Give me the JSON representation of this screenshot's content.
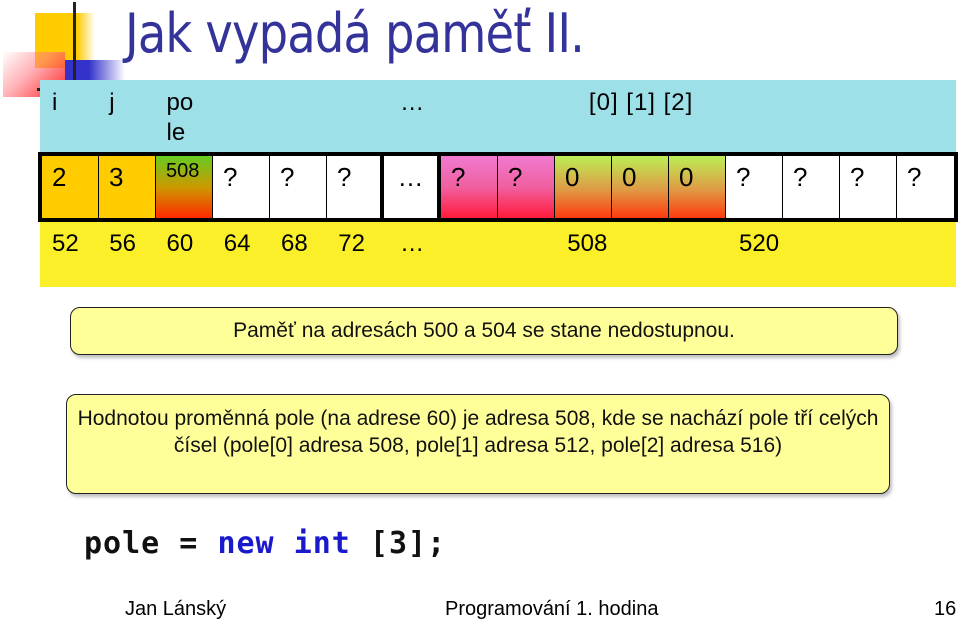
{
  "slide": {
    "title": "Jak vypadá paměť II.",
    "header_row": {
      "cells": [
        "i",
        "j",
        "po\nle",
        "",
        "",
        "",
        "…",
        "",
        "",
        "[0]  [1]  [2]",
        "",
        "",
        "",
        ""
      ]
    },
    "memory_row": {
      "cells": [
        {
          "value": "2",
          "kind": "orange"
        },
        {
          "value": "3",
          "kind": "orange"
        },
        {
          "value": "508",
          "kind": "pointer"
        },
        {
          "value": "?",
          "kind": "white"
        },
        {
          "value": "?",
          "kind": "white"
        },
        {
          "value": "?",
          "kind": "white"
        },
        {
          "value": "…",
          "kind": "white"
        },
        {
          "value": "?",
          "kind": "pink"
        },
        {
          "value": "?",
          "kind": "pink"
        },
        {
          "value": "0",
          "kind": "array"
        },
        {
          "value": "0",
          "kind": "array"
        },
        {
          "value": "0",
          "kind": "array"
        },
        {
          "value": "?",
          "kind": "white"
        },
        {
          "value": "?",
          "kind": "white"
        },
        {
          "value": "?",
          "kind": "white"
        },
        {
          "value": "?",
          "kind": "white"
        }
      ]
    },
    "address_row": {
      "cells": [
        "52",
        "56",
        "60",
        "64",
        "68",
        "72",
        "…",
        "",
        "",
        "508",
        "",
        "",
        "520",
        "",
        "",
        ""
      ]
    },
    "callout_unreachable": "Paměť na adresách 500 a 504 se stane nedostupnou.",
    "callout_explanation": "Hodnotou proměnná pole (na adrese 60) je adresa 508, kde se nachází pole tří celých čísel (pole[0] adresa 508, pole[1] adresa 512, pole[2] adresa 516)",
    "code": {
      "lhs": "pole = ",
      "kw_new": "new",
      "kw_int": "int",
      "rest": " [3];"
    },
    "footer": {
      "author": "Jan Lánský",
      "course": "Programování 1. hodina",
      "page": "16"
    },
    "colors": {
      "title": "#333399",
      "header_bg": "#9ee0e8",
      "address_bg": "#fbef2a",
      "callout_bg": "#ffff99",
      "keyword": "#1a1acc"
    }
  }
}
